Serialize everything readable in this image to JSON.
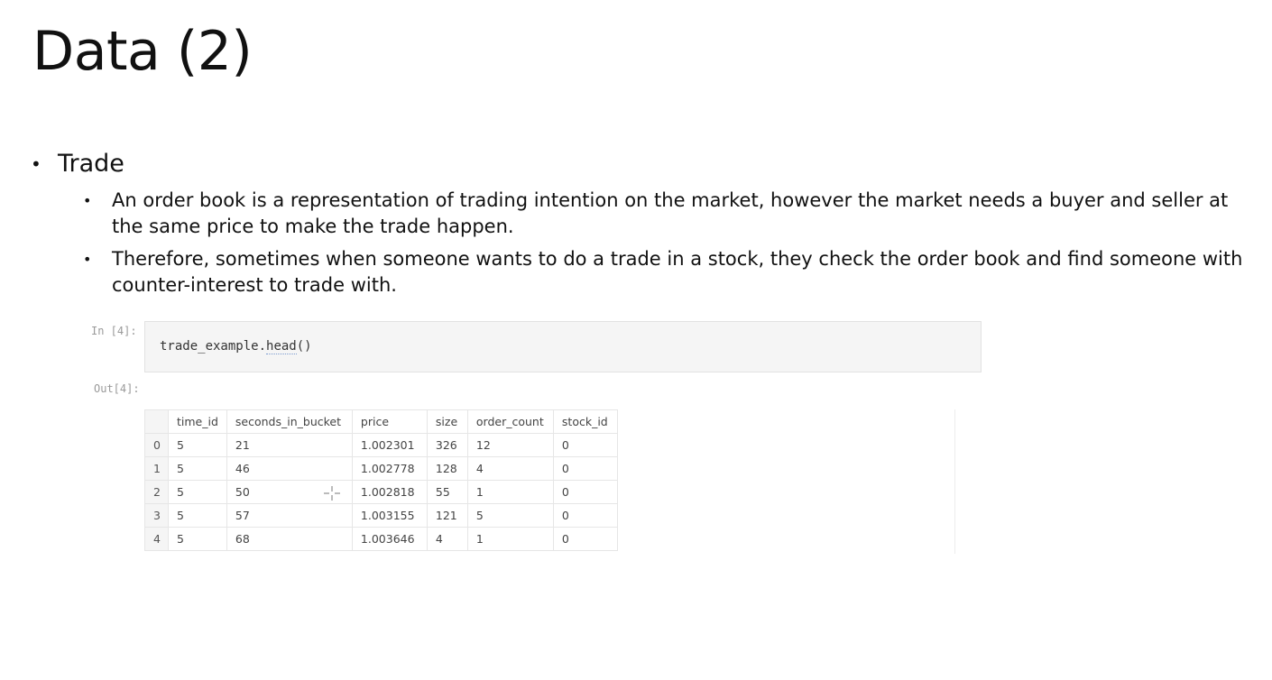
{
  "slide": {
    "title": "Data (2)"
  },
  "bullets": {
    "main": "Trade",
    "sub": [
      "An order book is a representation of trading intention on the market, however the market needs a buyer and seller at the same price to make the trade happen.",
      "Therefore, sometimes when someone wants to do a trade in a stock, they check the order book and find someone with counter-interest to trade with."
    ]
  },
  "notebook": {
    "in_prompt": "In [4]:",
    "out_prompt": "Out[4]:",
    "code_object": "trade_example.",
    "code_method": "head",
    "code_args": "()"
  },
  "table": {
    "columns": [
      "time_id",
      "seconds_in_bucket",
      "price",
      "size",
      "order_count",
      "stock_id"
    ],
    "rows": [
      {
        "index": "0",
        "cells": [
          "5",
          "21",
          "1.002301",
          "326",
          "12",
          "0"
        ]
      },
      {
        "index": "1",
        "cells": [
          "5",
          "46",
          "1.002778",
          "128",
          "4",
          "0"
        ]
      },
      {
        "index": "2",
        "cells": [
          "5",
          "50",
          "1.002818",
          "55",
          "1",
          "0"
        ]
      },
      {
        "index": "3",
        "cells": [
          "5",
          "57",
          "1.003155",
          "121",
          "5",
          "0"
        ]
      },
      {
        "index": "4",
        "cells": [
          "5",
          "68",
          "1.003646",
          "4",
          "1",
          "0"
        ]
      }
    ]
  },
  "icons": {
    "cursor": "crosshair-cursor-icon"
  }
}
